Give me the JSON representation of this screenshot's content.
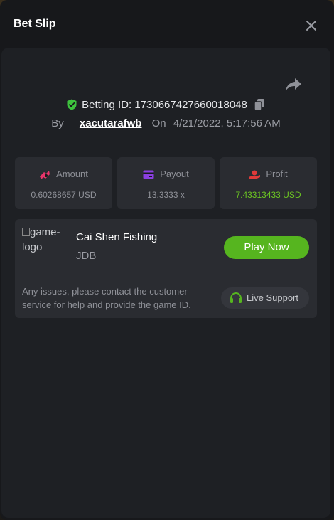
{
  "modal": {
    "title": "Bet Slip"
  },
  "bet": {
    "id_label": "Betting ID:",
    "id": "1730667427660018048",
    "by_label": "By",
    "user": "xacutarafwb",
    "on_label": "On",
    "datetime": "4/21/2022, 5:17:56 AM"
  },
  "stats": [
    {
      "label": "Amount",
      "value": "0.60268657 USD",
      "icon": "money-icon"
    },
    {
      "label": "Payout",
      "value": "13.3333 x",
      "icon": "card-icon"
    },
    {
      "label": "Profit",
      "value": "7.43313433 USD",
      "icon": "hand-coin-icon"
    }
  ],
  "game": {
    "logo_alt": "game-logo",
    "name": "Cai Shen Fishing",
    "provider": "JDB",
    "play_label": "Play Now",
    "notice": "Any issues, please contact the customer service for help and provide the game ID.",
    "support_label": "Live Support"
  },
  "colors": {
    "accent_green": "#56b51f",
    "profit_green": "#6cc622",
    "shield_green": "#3ec23e",
    "amount_icon": "#e8356a",
    "payout_icon": "#8b3fe0",
    "profit_icon": "#e03a3a"
  }
}
